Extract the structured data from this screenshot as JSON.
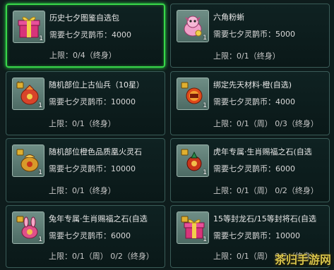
{
  "items": [
    {
      "name": "历史七夕图鉴自选包",
      "price": "需要七夕灵鹊币：4000",
      "limit": "上限：0/4（终身）",
      "count": "1",
      "icon": "gift-box-icon"
    },
    {
      "name": "六角粉蜥",
      "price": "需要七夕灵鹊币：5000",
      "limit": "上限：0/1（终身）",
      "count": "1",
      "icon": "pink-lizard-pet-icon"
    },
    {
      "name": "随机部位上古仙兵（10星）",
      "price": "需要七夕灵鹊币：10000",
      "limit": "上限：0/1（终身）",
      "count": "1",
      "icon": "locked-weapon-pouch-icon"
    },
    {
      "name": "绑定先天材料·橙(自选)",
      "price": "需要七夕灵鹊币：4000",
      "limit": "上限：0/1（周）  0/3（终身）",
      "count": "1",
      "icon": "locked-material-orb-icon"
    },
    {
      "name": "随机部位橙色品质凰火灵石",
      "price": "需要七夕灵鹊币：10000",
      "limit": "上限：0/1（终身）",
      "count": "1",
      "icon": "locked-golden-bag-icon"
    },
    {
      "name": "虎年专属·生肖赐福之石(自选",
      "price": "需要七夕灵鹊币：6000",
      "limit": "上限：0/1（周）  0/2（终身）",
      "count": "1",
      "icon": "locked-tiger-stone-icon"
    },
    {
      "name": "兔年专属·生肖赐福之石(自选",
      "price": "需要七夕灵鹊币：6000",
      "limit": "上限：0/1（周）  0/2（终身）",
      "count": "1",
      "icon": "locked-rabbit-stone-icon"
    },
    {
      "name": "15等封龙石/15等封将石(自选",
      "price": "需要七夕灵鹊币：10000",
      "limit": "上限：0/1（周）  0/2（终身）",
      "count": "1",
      "icon": "locked-gift-box-icon"
    }
  ],
  "watermark": "茶归手游网",
  "colors": {
    "selected_border": "#38d64a",
    "card_border": "#3a5c58",
    "background": "#0e1c1c"
  }
}
